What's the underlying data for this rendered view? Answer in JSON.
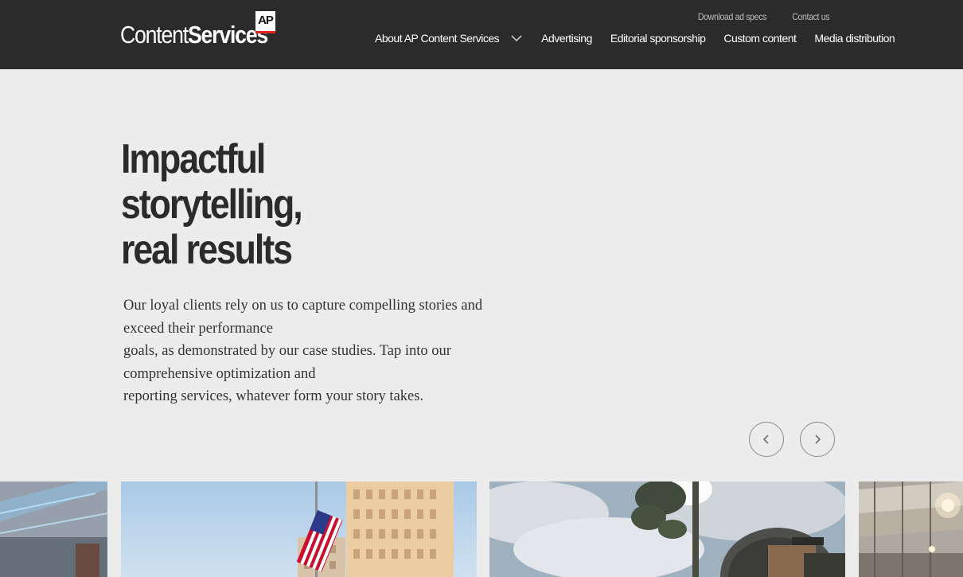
{
  "header": {
    "logo": {
      "light": "Content",
      "bold": "Services",
      "badge": "AP"
    },
    "utility_links": [
      "Download ad specs",
      "Contact us"
    ],
    "nav": [
      {
        "label": "About AP Content Services",
        "has_dropdown": true
      },
      {
        "label": "Advertising"
      },
      {
        "label": "Editorial sponsorship"
      },
      {
        "label": "Custom content"
      },
      {
        "label": "Media distribution"
      }
    ]
  },
  "hero": {
    "title_lines": [
      "Impactful",
      "storytelling,",
      "real results"
    ],
    "body_lines": [
      "Our loyal clients rely on us to capture compelling stories and",
      "exceed their performance",
      "goals, as demonstrated by our case studies. Tap into our",
      "comprehensive optimization and",
      "reporting services, whatever form your story takes."
    ]
  },
  "carousel": {
    "prev_icon": "chevron-left-icon",
    "next_icon": "chevron-right-icon"
  },
  "colors": {
    "header_bg": "#2b2b2b",
    "page_bg": "#ececec",
    "ap_red": "#e2231a"
  }
}
